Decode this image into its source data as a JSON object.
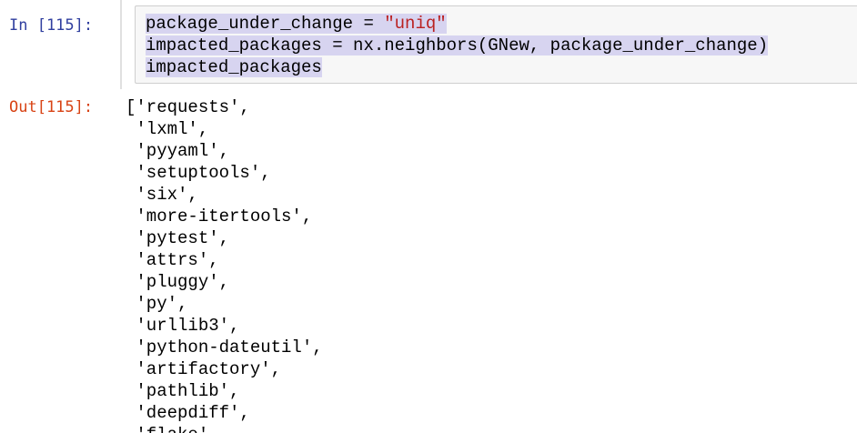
{
  "cell": {
    "in_prompt": "In [115]:",
    "out_prompt": "Out[115]:",
    "code_lines": [
      {
        "pre": "package_under_change = ",
        "str": "\"uniq\"",
        "post": ""
      },
      {
        "pre": "impacted_packages = nx.neighbors(GNew, package_under_change)",
        "str": "",
        "post": ""
      },
      {
        "pre": "impacted_packages",
        "str": "",
        "post": ""
      }
    ],
    "output_lines": [
      "['requests',",
      " 'lxml',",
      " 'pyyaml',",
      " 'setuptools',",
      " 'six',",
      " 'more-itertools',",
      " 'pytest',",
      " 'attrs',",
      " 'pluggy',",
      " 'py',",
      " 'urllib3',",
      " 'python-dateutil',",
      " 'artifactory',",
      " 'pathlib',",
      " 'deepdiff',",
      " 'flake'"
    ]
  },
  "colors": {
    "in_prompt": "#303f9f",
    "out_prompt": "#d84315",
    "string": "#ba2121",
    "selection": "#d7d4f0",
    "input_bg": "#f7f7f7"
  }
}
